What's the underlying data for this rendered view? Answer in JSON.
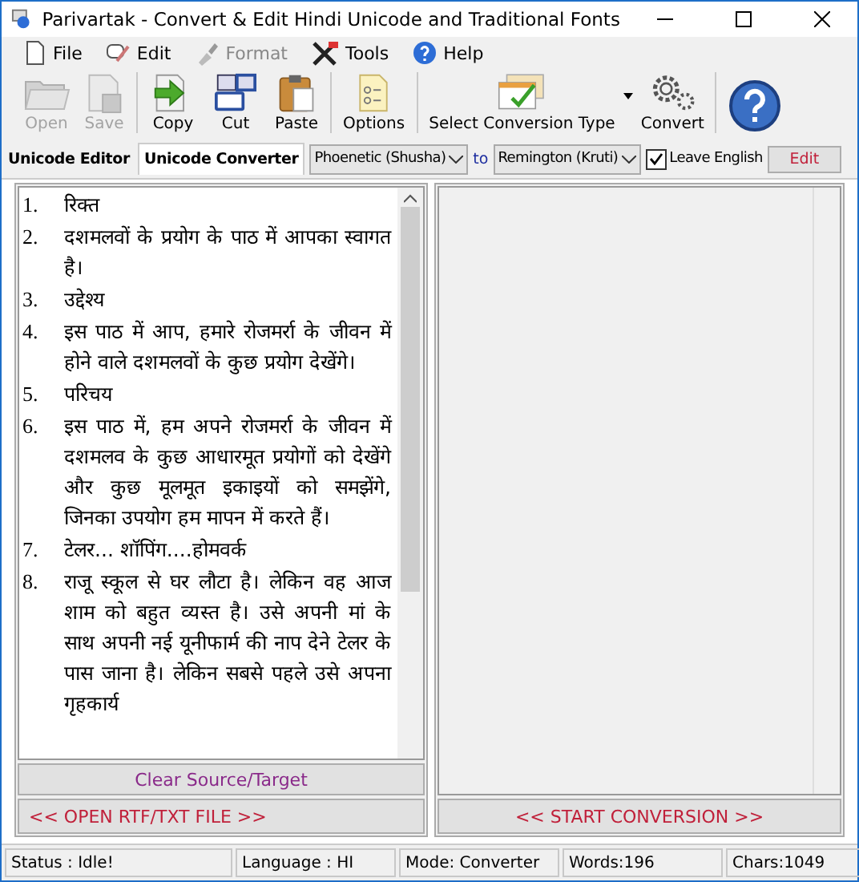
{
  "window": {
    "title": "Parivartak - Convert & Edit Hindi Unicode and Traditional Fonts"
  },
  "menu": [
    {
      "label": "File",
      "disabled": false
    },
    {
      "label": "Edit",
      "disabled": false
    },
    {
      "label": "Format",
      "disabled": true
    },
    {
      "label": "Tools",
      "disabled": false
    },
    {
      "label": "Help",
      "disabled": false
    }
  ],
  "toolbar": [
    [
      {
        "label": "Open",
        "disabled": true
      },
      {
        "label": "Save",
        "disabled": true
      }
    ],
    [
      {
        "label": "Copy",
        "disabled": false
      },
      {
        "label": "Cut",
        "disabled": false
      },
      {
        "label": "Paste",
        "disabled": false
      }
    ],
    [
      {
        "label": "Options",
        "disabled": false
      }
    ],
    [
      {
        "label": "Select Conversion Type",
        "disabled": false,
        "dropdown": true
      },
      {
        "label": "Convert",
        "disabled": false
      }
    ],
    [
      {
        "disabled": false
      }
    ]
  ],
  "tabs": [
    {
      "label": "Unicode Editor",
      "selected": false
    },
    {
      "label": "Unicode Converter",
      "selected": true
    }
  ],
  "converter": {
    "from": "Phoenetic (Shusha)",
    "to_label": "to",
    "to": "Remington (Kruti)",
    "leave_english": {
      "label": "Leave English",
      "checked": true
    },
    "edit_button": "Edit"
  },
  "source": [
    {
      "number": "1.",
      "text": "रिक्त"
    },
    {
      "number": "2.",
      "text": "दशमलवों के प्रयोग के पाठ में आपका स्वागत है।"
    },
    {
      "number": "3.",
      "text": "उद्देश्य"
    },
    {
      "number": "4.",
      "text": "इस पाठ में आप, हमारे रोजमर्रा के जीवन में होने वाले दशमलवों के कुछ प्रयोग देखेंगे।"
    },
    {
      "number": "5.",
      "text": "परिचय"
    },
    {
      "number": "6.",
      "text": "इस पाठ में, हम अपने रोजमर्रा के जीवन में दशमलव के कुछ आधारमूत प्रयोगों को देखेंगे और कुछ मूलमूत इकाइयों को समझेंगे, जिनका उपयोग हम मापन में करते हैं।"
    },
    {
      "number": "7.",
      "text": "टेलर... शॉपिंग....होमवर्क"
    },
    {
      "number": "8.",
      "text": "राजू स्कूल से घर लौटा है। लेकिन वह आज शाम को बहुत व्यस्त है। उसे अपनी मां के साथ अपनी नई यूनीफार्म की नाप देने टेलर के पास जाना है। लेकिन सबसे पहले उसे अपना गृहकार्य"
    }
  ],
  "clear_button": "Clear Source/Target",
  "open_button": "<< OPEN RTF/TXT FILE >>",
  "start_button": "<< START CONVERSION >>",
  "status_bar": [
    "Status :  Idle!",
    "Language : HI",
    "Mode: Converter",
    "Words:196",
    "Chars:1049"
  ]
}
